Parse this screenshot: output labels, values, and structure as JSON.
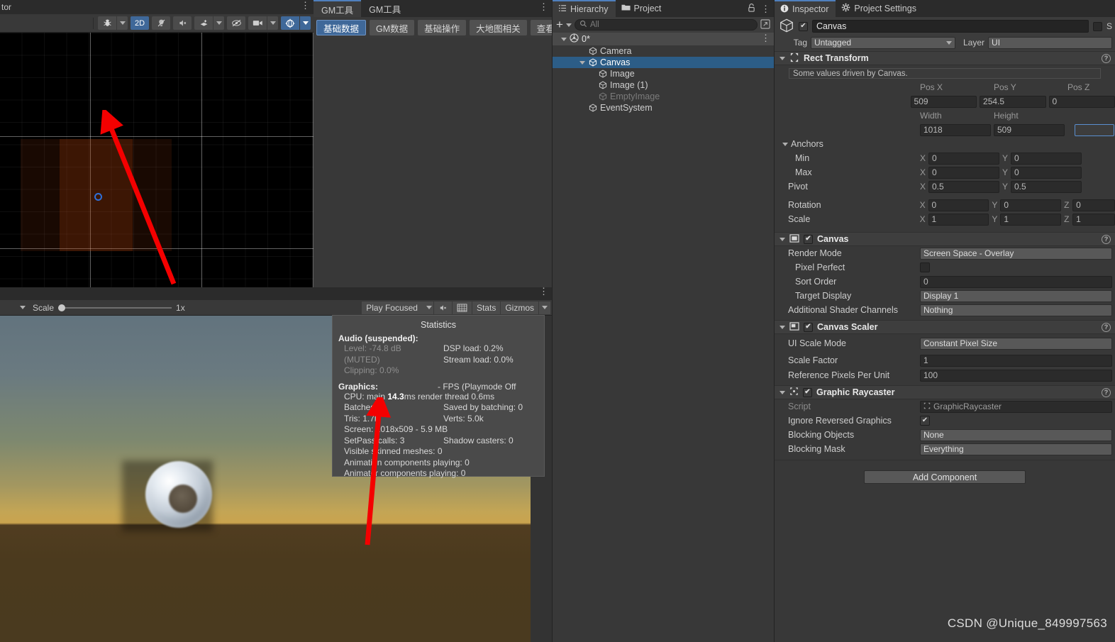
{
  "window": {
    "title_fragment": "tor"
  },
  "scene": {
    "tab_label": "",
    "toolbar_buttons": [
      {
        "name": "draw-mode-bug",
        "icon": "bug-icon",
        "label": "",
        "active": false,
        "has_dropdown": true
      },
      {
        "name": "2d-toggle",
        "icon": "",
        "label": "2D",
        "active": true,
        "has_dropdown": false
      },
      {
        "name": "lighting-toggle",
        "icon": "lightbulb-off-icon",
        "label": "",
        "active": false,
        "has_dropdown": false
      },
      {
        "name": "audio-toggle",
        "icon": "speaker-muted-icon",
        "label": "",
        "active": false,
        "has_dropdown": false
      },
      {
        "name": "effects-toggle",
        "icon": "fx-icon",
        "label": "",
        "active": false,
        "has_dropdown": true
      },
      {
        "name": "hidden-objects-toggle",
        "icon": "eye-off-icon",
        "label": "",
        "active": false,
        "has_dropdown": false
      },
      {
        "name": "camera-settings",
        "icon": "camera-icon",
        "label": "",
        "active": false,
        "has_dropdown": true
      },
      {
        "name": "gizmos-toggle",
        "icon": "gizmo-globe-icon",
        "label": "",
        "active": true,
        "has_dropdown": true
      }
    ],
    "grid": {
      "visible": true
    },
    "canvas_rect": {
      "visible": true,
      "color": "#c84b0f"
    },
    "pivot_color": "#2f6fd8"
  },
  "gm_tool": {
    "tabs": [
      {
        "label": "GM工具",
        "active": true
      },
      {
        "label": "GM工具",
        "active": false
      }
    ],
    "buttons": [
      {
        "label": "基础数据",
        "active": true
      },
      {
        "label": "GM数据",
        "active": false
      },
      {
        "label": "基础操作",
        "active": false
      },
      {
        "label": "大地图相关",
        "active": false
      },
      {
        "label": "查看",
        "active": false
      }
    ]
  },
  "game": {
    "toolbar": {
      "scale_label": "Scale",
      "scale_value": "1x",
      "play_mode": "Play Focused",
      "mute_audio_icon": "speaker-muted-icon",
      "aspect_icon": "grid-icon",
      "stats_label": "Stats",
      "gizmos_label": "Gizmos"
    },
    "statistics": {
      "title": "Statistics",
      "audio_header": "Audio (suspended):",
      "audio_level": "Level: -74.8 dB (MUTED)",
      "audio_clipping": "Clipping: 0.0%",
      "dsp_load": "DSP load: 0.2%",
      "stream_load": "Stream load: 0.0%",
      "graphics_header": "Graphics:",
      "fps": "- FPS (Playmode Off",
      "cpu_prefix": "CPU: main ",
      "cpu_main": "14.3",
      "cpu_suffix": "ms  render thread 0.6ms",
      "batches_label": "Batches: ",
      "batches_value": "3",
      "saved_by_batching": "Saved by batching: 0",
      "tris": "Tris: 1.7k",
      "verts": "Verts: 5.0k",
      "screen": "Screen: 1018x509 - 5.9 MB",
      "setpass": "SetPass calls: 3",
      "shadow_casters": "Shadow casters: 0",
      "visible_skinned": "Visible skinned meshes: 0",
      "animation_components": "Animation components playing: 0",
      "animator_components": "Animator components playing: 0"
    }
  },
  "hierarchy": {
    "tabs": [
      {
        "label": "Hierarchy",
        "icon": "hierarchy-icon",
        "active": true
      },
      {
        "label": "Project",
        "icon": "folder-icon",
        "active": false
      }
    ],
    "lock_icon": "lock-icon",
    "add_label": "+",
    "search_placeholder": "All",
    "root": {
      "label": "0*",
      "icon": "unity-scene-icon"
    },
    "items": [
      {
        "label": "Camera",
        "depth": 2,
        "selected": false,
        "faded": false,
        "expandable": false
      },
      {
        "label": "Canvas",
        "depth": 2,
        "selected": true,
        "faded": false,
        "expandable": true
      },
      {
        "label": "Image",
        "depth": 3,
        "selected": false,
        "faded": false,
        "expandable": false
      },
      {
        "label": "Image (1)",
        "depth": 3,
        "selected": false,
        "faded": false,
        "expandable": false
      },
      {
        "label": "EmptyImage",
        "depth": 3,
        "selected": false,
        "faded": true,
        "expandable": false
      },
      {
        "label": "EventSystem",
        "depth": 2,
        "selected": false,
        "faded": false,
        "expandable": false
      }
    ]
  },
  "inspector": {
    "tabs": [
      {
        "label": "Inspector",
        "icon": "info-icon",
        "active": true
      },
      {
        "label": "Project Settings",
        "icon": "gear-icon",
        "active": false
      }
    ],
    "object": {
      "name": "Canvas",
      "enabled": true,
      "static_label": "S",
      "tag_label": "Tag",
      "tag_value": "Untagged",
      "layer_label": "Layer",
      "layer_value": "UI"
    },
    "rect_transform": {
      "title": "Rect Transform",
      "note": "Some values driven by Canvas.",
      "pos_x_label": "Pos X",
      "pos_y_label": "Pos Y",
      "pos_z_label": "Pos Z",
      "pos_x": "509",
      "pos_y": "254.5",
      "pos_z": "0",
      "width_label": "Width",
      "height_label": "Height",
      "width": "1018",
      "height": "509",
      "anchors_label": "Anchors",
      "min_label": "Min",
      "min_x": "0",
      "min_y": "0",
      "max_label": "Max",
      "max_x": "0",
      "max_y": "0",
      "pivot_label": "Pivot",
      "pivot_x": "0.5",
      "pivot_y": "0.5",
      "rotation_label": "Rotation",
      "rot_x": "0",
      "rot_y": "0",
      "rot_z": "0",
      "scale_label": "Scale",
      "scale_x": "1",
      "scale_y": "1",
      "scale_z": "1"
    },
    "canvas": {
      "title": "Canvas",
      "enabled": true,
      "render_mode_label": "Render Mode",
      "render_mode_value": "Screen Space - Overlay",
      "pixel_perfect_label": "Pixel Perfect",
      "pixel_perfect_value": false,
      "sort_order_label": "Sort Order",
      "sort_order_value": "0",
      "target_display_label": "Target Display",
      "target_display_value": "Display 1",
      "shader_channels_label": "Additional Shader Channels",
      "shader_channels_value": "Nothing"
    },
    "canvas_scaler": {
      "title": "Canvas Scaler",
      "enabled": true,
      "ui_scale_mode_label": "UI Scale Mode",
      "ui_scale_mode_value": "Constant Pixel Size",
      "scale_factor_label": "Scale Factor",
      "scale_factor_value": "1",
      "ref_ppu_label": "Reference Pixels Per Unit",
      "ref_ppu_value": "100"
    },
    "graphic_raycaster": {
      "title": "Graphic Raycaster",
      "enabled": true,
      "script_label": "Script",
      "script_value": "GraphicRaycaster",
      "ignore_reversed_label": "Ignore Reversed Graphics",
      "ignore_reversed_value": true,
      "blocking_objects_label": "Blocking Objects",
      "blocking_objects_value": "None",
      "blocking_mask_label": "Blocking Mask",
      "blocking_mask_value": "Everything"
    },
    "add_component_label": "Add Component"
  },
  "watermark": "CSDN @Unique_849997563",
  "colors": {
    "accent_blue": "#3f6899",
    "selection_blue": "#2c5d87",
    "panel_bg": "#383838",
    "header_bg": "#2b2b2b",
    "arrow_red": "#f40000"
  }
}
